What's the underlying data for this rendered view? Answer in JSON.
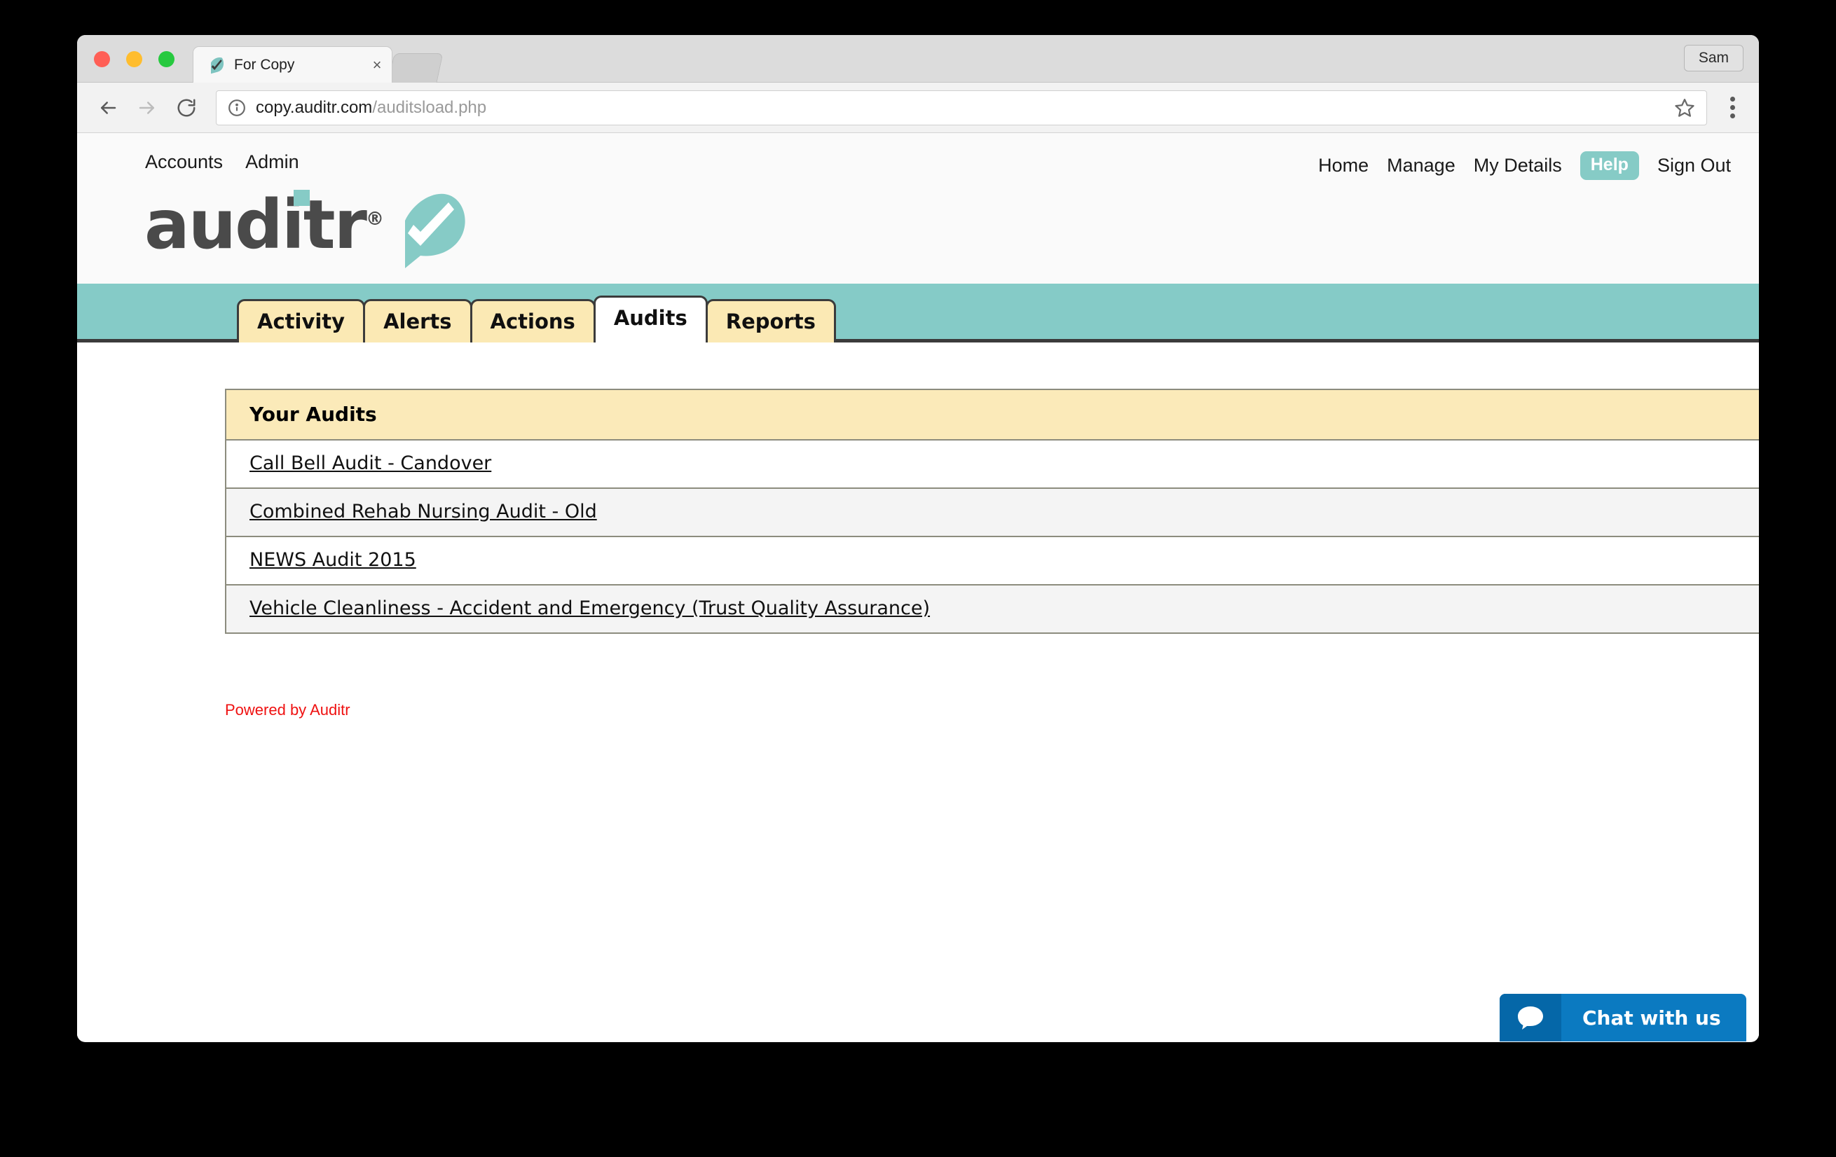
{
  "browser": {
    "tab": {
      "title": "For Copy",
      "favicon_name": "auditr-leaf-favicon",
      "close_label": "×"
    },
    "profile_label": "Sam",
    "toolbar": {
      "back_icon": "back-arrow-icon",
      "forward_icon": "forward-arrow-icon",
      "reload_icon": "reload-icon",
      "info_icon": "info-icon",
      "url_domain": "copy.auditr.com",
      "url_path": "/auditsload.php",
      "star_icon": "star-bookmark-icon",
      "menu_icon": "three-dot-menu-icon"
    }
  },
  "site": {
    "nav_left": [
      {
        "label": "Accounts"
      },
      {
        "label": "Admin"
      }
    ],
    "nav_right": [
      {
        "label": "Home",
        "badge": false
      },
      {
        "label": "Manage",
        "badge": false
      },
      {
        "label": "My Details",
        "badge": false
      },
      {
        "label": "Help",
        "badge": true
      },
      {
        "label": "Sign Out",
        "badge": false
      }
    ],
    "logo": {
      "text": "auditr",
      "registered": "®",
      "mark_name": "leaf-check-logo-mark"
    },
    "tabs": [
      {
        "label": "Activity",
        "active": false
      },
      {
        "label": "Alerts",
        "active": false
      },
      {
        "label": "Actions",
        "active": false
      },
      {
        "label": "Audits",
        "active": true
      },
      {
        "label": "Reports",
        "active": false
      }
    ],
    "audits_table": {
      "header": "Your Audits",
      "rows": [
        {
          "label": "Call Bell Audit - Candover"
        },
        {
          "label": "Combined Rehab Nursing Audit - Old"
        },
        {
          "label": "NEWS Audit 2015"
        },
        {
          "label": "Vehicle Cleanliness - Accident and Emergency (Trust Quality Assurance)"
        }
      ]
    },
    "footer": {
      "powered_by": "Powered by Auditr"
    },
    "chat": {
      "label": "Chat with us",
      "icon_name": "chat-bubble-icon"
    }
  },
  "colors": {
    "teal": "#85cbc7",
    "cream": "#fbe9b4",
    "table_header": "#fbeab9",
    "logo_gray": "#4a4a4a",
    "footer_red": "#ef1111",
    "chat_blue": "#0b7ac1",
    "chat_blue_dark": "#0567a8"
  }
}
